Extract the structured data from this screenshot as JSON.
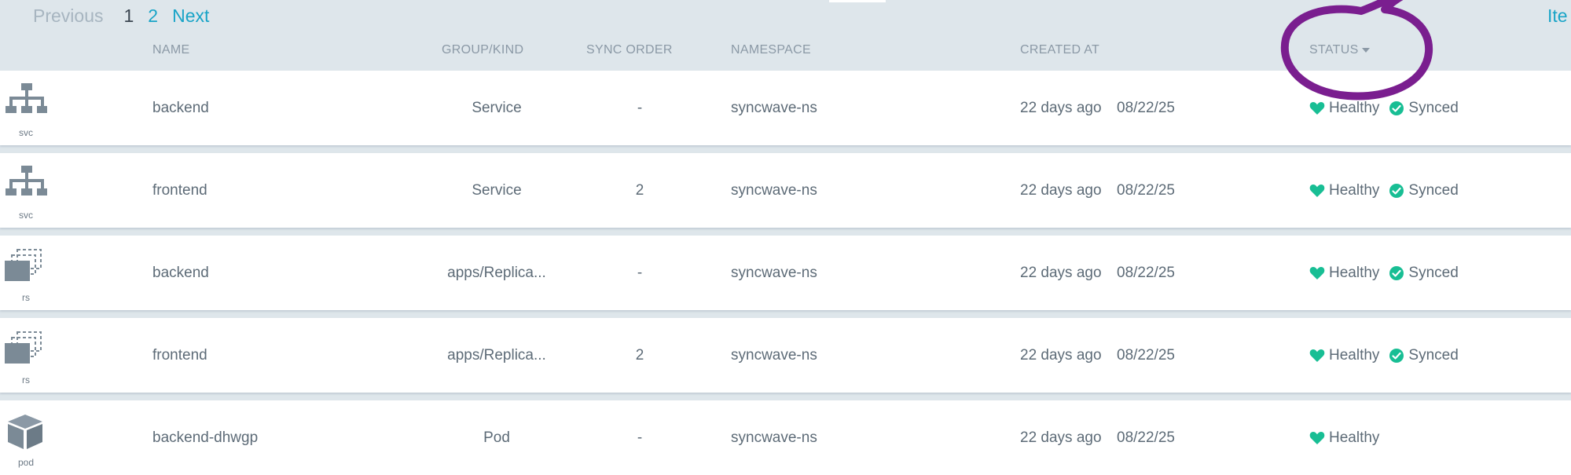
{
  "pager": {
    "previous": "Previous",
    "page1": "1",
    "page2": "2",
    "next": "Next",
    "items_label_partial": "Ite"
  },
  "columns": {
    "name": "NAME",
    "group_kind": "GROUP/KIND",
    "sync_order": "SYNC ORDER",
    "namespace": "NAMESPACE",
    "created_at": "CREATED AT",
    "status": "STATUS"
  },
  "colors": {
    "healthy": "#18be94",
    "synced": "#18be94",
    "annotation": "#7a1e8f",
    "link": "#19a4c7"
  },
  "rows": [
    {
      "icon": "service-network-icon",
      "kind_short": "svc",
      "name": "backend",
      "group_kind": "Service",
      "sync_order": "-",
      "namespace": "syncwave-ns",
      "created_ago": "22 days ago",
      "created_date": "08/22/25",
      "health": "Healthy",
      "sync": "Synced"
    },
    {
      "icon": "service-network-icon",
      "kind_short": "svc",
      "name": "frontend",
      "group_kind": "Service",
      "sync_order": "2",
      "namespace": "syncwave-ns",
      "created_ago": "22 days ago",
      "created_date": "08/22/25",
      "health": "Healthy",
      "sync": "Synced"
    },
    {
      "icon": "replicaset-stack-icon",
      "kind_short": "rs",
      "name": "backend",
      "group_kind": "apps/Replica...",
      "sync_order": "-",
      "namespace": "syncwave-ns",
      "created_ago": "22 days ago",
      "created_date": "08/22/25",
      "health": "Healthy",
      "sync": "Synced"
    },
    {
      "icon": "replicaset-stack-icon",
      "kind_short": "rs",
      "name": "frontend",
      "group_kind": "apps/Replica...",
      "sync_order": "2",
      "namespace": "syncwave-ns",
      "created_ago": "22 days ago",
      "created_date": "08/22/25",
      "health": "Healthy",
      "sync": "Synced"
    },
    {
      "icon": "pod-cube-icon",
      "kind_short": "pod",
      "name": "backend-dhwgp",
      "group_kind": "Pod",
      "sync_order": "-",
      "namespace": "syncwave-ns",
      "created_ago": "22 days ago",
      "created_date": "08/22/25",
      "health": "Healthy",
      "sync": ""
    }
  ]
}
